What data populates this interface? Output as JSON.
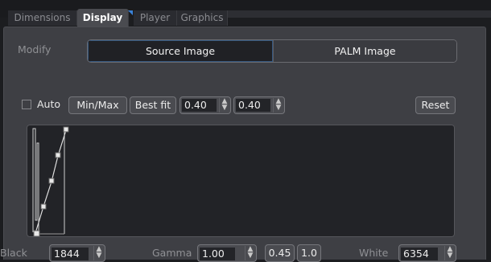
{
  "tabs": [
    "Dimensions",
    "Display",
    "Player",
    "Graphics"
  ],
  "modify": {
    "label": "Modify",
    "options": [
      "Source Image",
      "PALM Image"
    ],
    "selected": "Source Image"
  },
  "controls": {
    "auto_label": "Auto",
    "auto_checked": false,
    "minmax_label": "Min/Max",
    "bestfit_label": "Best fit",
    "value1": "0.40",
    "value2": "0.40",
    "reset_label": "Reset"
  },
  "bottom": {
    "black_label": "Black",
    "black_value": "1844",
    "gamma_label": "Gamma",
    "gamma_value": "1.00",
    "preset_045": "0.45",
    "preset_10": "1.0",
    "white_label": "White",
    "white_value": "6354"
  },
  "colors": {
    "accent": "#3a82d8",
    "panel": "#3e3f44",
    "histogram_bg": "#222327"
  }
}
